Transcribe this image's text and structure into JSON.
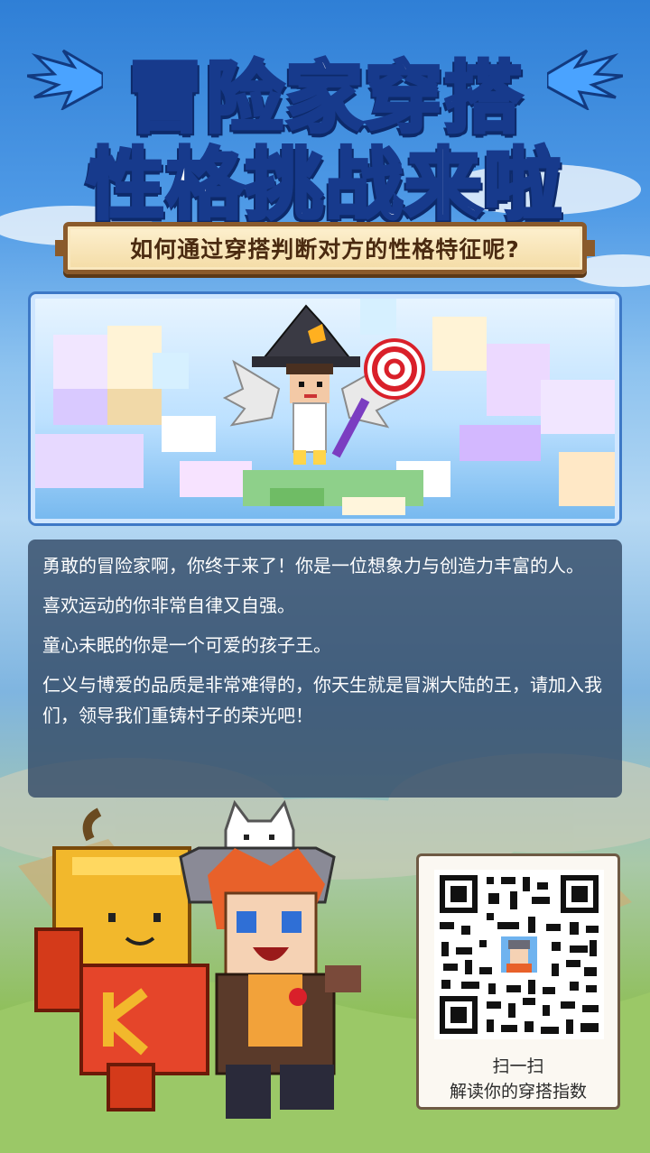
{
  "title": {
    "line1": "冒险家穿搭",
    "line2": "性格挑战来啦"
  },
  "subtitle": "如何通过穿搭判断对方的性格特征呢?",
  "description": {
    "paragraphs": [
      "勇敢的冒险家啊，你终于来了！你是一位想象力与创造力丰富的人。",
      "喜欢运动的你非常自律又自强。",
      "童心未眠的你是一个可爱的孩子王。",
      "仁义与博爱的品质是非常难得的，你天生就是冒渊大陆的王，请加入我们，领导我们重铸村子的荣光吧！"
    ]
  },
  "qr": {
    "caption_line1": "扫一扫",
    "caption_line2": "解读你的穿搭指数"
  },
  "icons": {
    "title_wings": "wing-icon",
    "hero_item": "lollipop-wand-icon"
  },
  "colors": {
    "title_fill": "#ffffff",
    "title_outline": "#173a8c",
    "banner_bg": "#f4dca6",
    "banner_border": "#8a5a2b",
    "panel_bg": "#344c68"
  }
}
